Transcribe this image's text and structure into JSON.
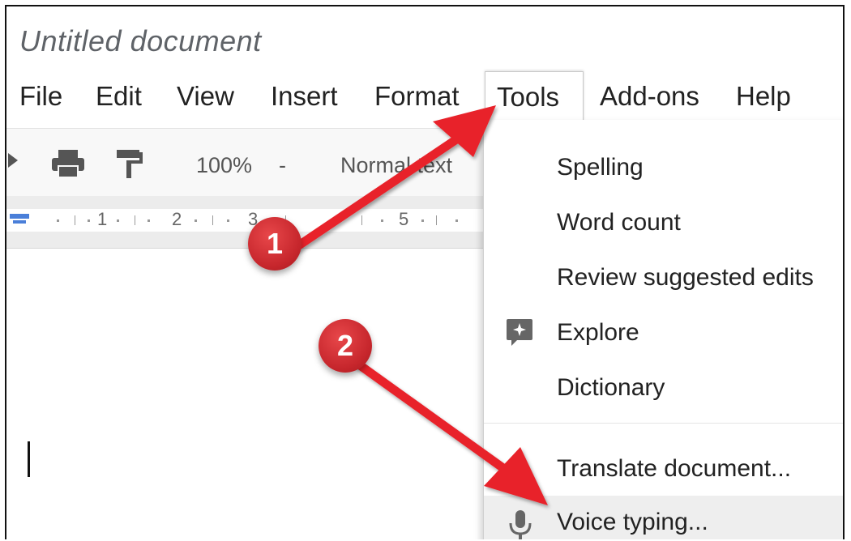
{
  "document": {
    "title": "Untitled document"
  },
  "menubar": {
    "items": [
      {
        "label": "File"
      },
      {
        "label": "Edit"
      },
      {
        "label": "View"
      },
      {
        "label": "Insert"
      },
      {
        "label": "Format"
      },
      {
        "label": "Tools",
        "active": true
      },
      {
        "label": "Add-ons"
      },
      {
        "label": "Help"
      }
    ]
  },
  "toolbar": {
    "zoom": "100%",
    "zoom_arrow": "-",
    "style": "Normal text",
    "icons": [
      "redo-icon",
      "print-icon",
      "paint-format-icon"
    ]
  },
  "ruler": {
    "numbers": [
      "1",
      "2",
      "3",
      "5"
    ]
  },
  "tools_menu": {
    "items": [
      {
        "label": "Spelling"
      },
      {
        "label": "Word count"
      },
      {
        "label": "Review suggested edits"
      },
      {
        "label": "Explore",
        "icon": "explore-icon"
      },
      {
        "label": "Dictionary"
      },
      {
        "label": "Translate document..."
      },
      {
        "label": "Voice typing...",
        "icon": "microphone-icon",
        "highlighted": true
      }
    ]
  },
  "annotations": {
    "badges": [
      "1",
      "2"
    ],
    "arrow_color": "#e8232a"
  },
  "colors": {
    "menu_text": "#222222",
    "title_text": "#5f6368",
    "highlight_bg": "#eeeeee"
  }
}
